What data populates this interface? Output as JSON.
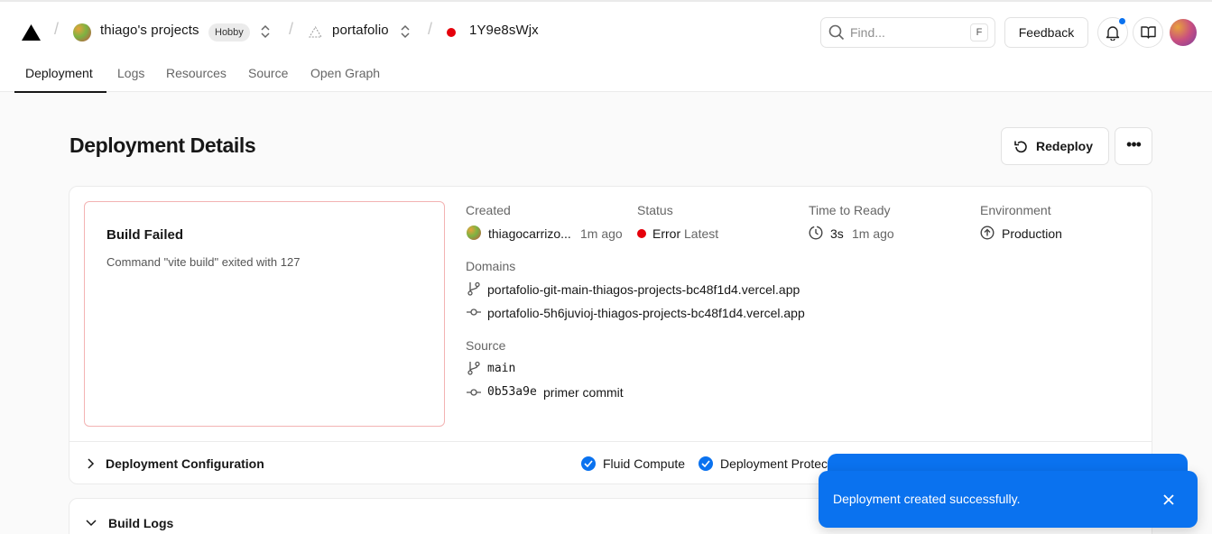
{
  "header": {
    "team_name": "thiago's projects",
    "plan_badge": "Hobby",
    "project_name": "portafolio",
    "deployment_id": "1Y9e8sWjx",
    "search": {
      "placeholder": "Find...",
      "shortcut": "F"
    },
    "feedback_label": "Feedback",
    "notification_dot_color": "#0a72ef"
  },
  "tabs": [
    {
      "label": "Deployment",
      "active": true
    },
    {
      "label": "Logs"
    },
    {
      "label": "Resources"
    },
    {
      "label": "Source"
    },
    {
      "label": "Open Graph"
    }
  ],
  "page": {
    "title": "Deployment Details",
    "redeploy_label": "Redeploy",
    "more_label": "•••"
  },
  "build": {
    "title": "Build Failed",
    "message": "Command \"vite build\" exited with 127",
    "border_color": "#f3b3b3"
  },
  "details": {
    "created_label": "Created",
    "created_user": "thiagocarrizo...",
    "created_time": "1m ago",
    "status_label": "Status",
    "status_value": "Error",
    "status_tag": "Latest",
    "status_color": "#e5000b",
    "ttr_label": "Time to Ready",
    "ttr_value": "3s",
    "ttr_time": "1m ago",
    "env_label": "Environment",
    "env_value": "Production",
    "domains_label": "Domains",
    "domains": [
      "portafolio-git-main-thiagos-projects-bc48f1d4.vercel.app",
      "portafolio-5h6juvioj-thiagos-projects-bc48f1d4.vercel.app"
    ],
    "source_label": "Source",
    "source_branch": "main",
    "source_commit_hash": "0b53a9e",
    "source_commit_msg": "primer commit"
  },
  "config": {
    "label": "Deployment Configuration",
    "features": [
      "Fluid Compute",
      "Deployment Protec"
    ]
  },
  "build_logs_label": "Build Logs",
  "toast": {
    "message": "Deployment created successfully.",
    "color": "#0a72ef"
  }
}
